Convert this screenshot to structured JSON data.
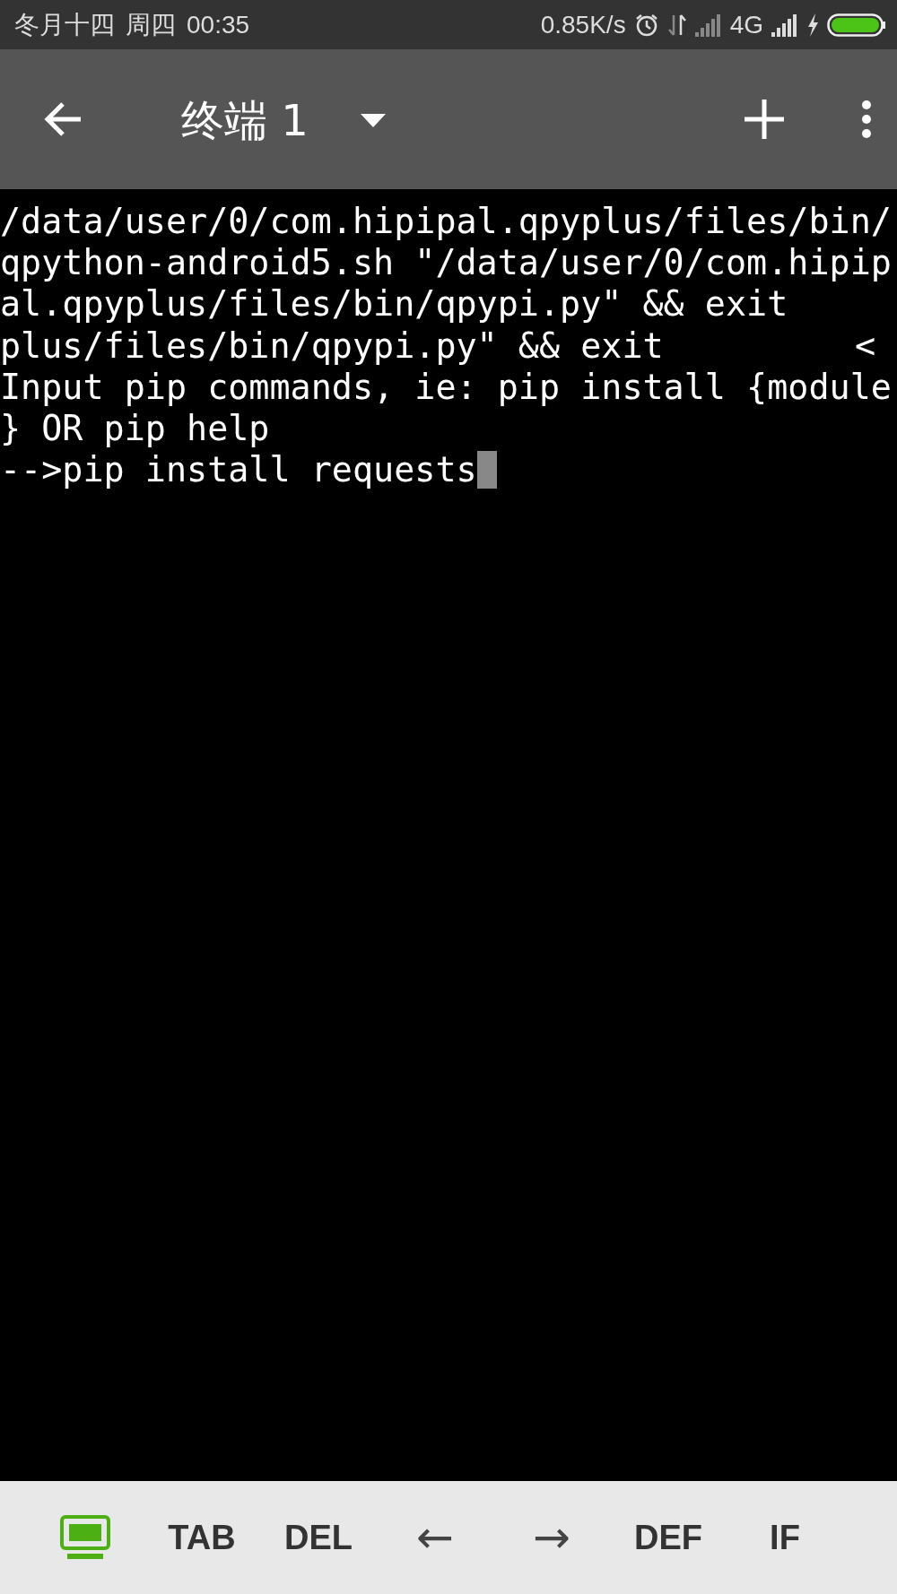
{
  "status_bar": {
    "lunar_date": "冬月十四",
    "weekday": "周四",
    "time": "00:35",
    "network_speed": "0.85K/s",
    "network_type": "4G"
  },
  "app_bar": {
    "title": "终端 1"
  },
  "terminal": {
    "lines": [
      {
        "text": "/data/user/0/com.hipipal.qpyplus/files/bin/",
        "cursor": false
      },
      {
        "text": "qpython-android5.sh \"/data/user/0/com.hipip",
        "cursor": false
      },
      {
        "text": "al.qpyplus/files/bin/qpypi.py\" && exit",
        "cursor": false
      },
      {
        "text": "plus/files/bin/qpypi.py\" && exit",
        "margin_mark": "<",
        "cursor": false
      },
      {
        "text": "Input pip commands, ie: pip install {module",
        "cursor": false
      },
      {
        "text": "} OR pip help",
        "cursor": false
      },
      {
        "text": "-->pip install requests",
        "cursor": true
      }
    ]
  },
  "keys": [
    {
      "kind": "icon"
    },
    {
      "kind": "text",
      "label": "TAB"
    },
    {
      "kind": "text",
      "label": "DEL"
    },
    {
      "kind": "arrow",
      "label": "←"
    },
    {
      "kind": "arrow",
      "label": "→"
    },
    {
      "kind": "text",
      "label": "DEF"
    },
    {
      "kind": "text",
      "label": "IF"
    }
  ]
}
